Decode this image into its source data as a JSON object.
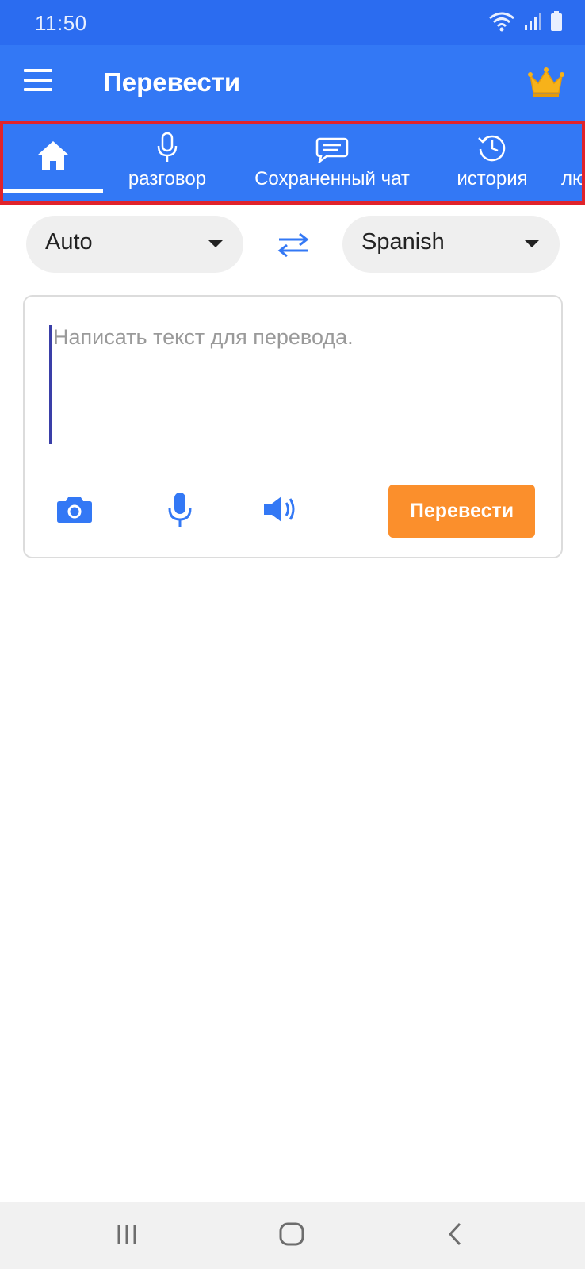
{
  "status_bar": {
    "time": "11:50",
    "icons": [
      "wifi-icon",
      "signal-icon",
      "battery-icon"
    ]
  },
  "app_bar": {
    "title": "Перевести",
    "menu_icon": "hamburger-menu-icon",
    "premium_icon": "crown-icon"
  },
  "tabs": {
    "items": [
      {
        "icon": "home-icon",
        "label": "",
        "active": true
      },
      {
        "icon": "microphone-icon",
        "label": "разговор",
        "active": false
      },
      {
        "icon": "chat-bubble-icon",
        "label": "Сохраненный чат",
        "active": false
      },
      {
        "icon": "history-icon",
        "label": "история",
        "active": false
      },
      {
        "icon": "",
        "label": "лю",
        "active": false
      }
    ]
  },
  "languages": {
    "source": "Auto",
    "target": "Spanish",
    "swap_icon": "swap-arrows-icon"
  },
  "input": {
    "placeholder": "Написать текст для перевода.",
    "value": ""
  },
  "tools": {
    "camera_icon": "camera-icon",
    "mic_icon": "microphone-icon",
    "speaker_icon": "speaker-icon",
    "translate_label": "Перевести"
  },
  "colors": {
    "status_bar": "#2b6cf0",
    "app_bar": "#3378f5",
    "accent_blue": "#3378f5",
    "translate_button": "#fb8f2c",
    "crown": "#f7b21a",
    "highlight_border": "#e0232b"
  },
  "nav_bar": {
    "icons": [
      "recent-apps-icon",
      "home-circle-icon",
      "back-icon"
    ]
  }
}
